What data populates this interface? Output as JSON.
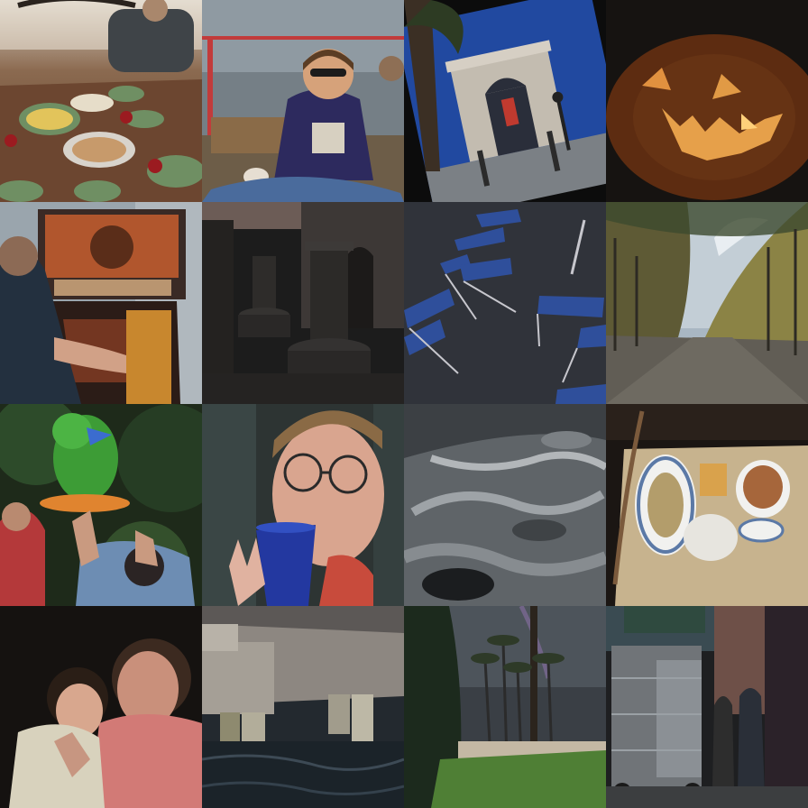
{
  "grid": {
    "rows": 4,
    "cols": 4,
    "tiles": [
      {
        "subject": "dinner-table",
        "palette": [
          "#6b4a32",
          "#d9b86a",
          "#6f8f63"
        ]
      },
      {
        "subject": "boat-deck-people",
        "palette": [
          "#6f7f88",
          "#2d2a5e",
          "#c98d5a"
        ]
      },
      {
        "subject": "arc-de-triomphe",
        "palette": [
          "#1f3f7e",
          "#b8b3aa",
          "#2d2a25"
        ]
      },
      {
        "subject": "jack-o-lantern",
        "palette": [
          "#1b1613",
          "#5a2a10",
          "#e39a42"
        ]
      },
      {
        "subject": "pinball-machine",
        "palette": [
          "#9aa6b0",
          "#2b1d18",
          "#c56f35"
        ]
      },
      {
        "subject": "stone-ruins",
        "palette": [
          "#1e1d1d",
          "#3b3a39",
          "#7a6253"
        ]
      },
      {
        "subject": "blue-folding-chairs",
        "palette": [
          "#2d3039",
          "#2f4f9b",
          "#c7c7cd"
        ]
      },
      {
        "subject": "tree-lined-park-path",
        "palette": [
          "#aab8c4",
          "#7b7b4d",
          "#565249"
        ]
      },
      {
        "subject": "green-parrot-pinata",
        "palette": [
          "#23311d",
          "#3ea039",
          "#b33a35"
        ]
      },
      {
        "subject": "man-with-blue-cup",
        "palette": [
          "#2c3434",
          "#e1aa93",
          "#233b9c"
        ]
      },
      {
        "subject": "tree-bark-texture",
        "palette": [
          "#1d1f21",
          "#6d7377",
          "#b9bcbf"
        ]
      },
      {
        "subject": "food-tray",
        "palette": [
          "#1c1713",
          "#c9b590",
          "#5b79a6"
        ]
      },
      {
        "subject": "woman-and-child",
        "palette": [
          "#1b1612",
          "#d07a74",
          "#d9d4c0"
        ]
      },
      {
        "subject": "bridge-pier-water",
        "palette": [
          "#5a5653",
          "#b6b0a6",
          "#1f2830"
        ]
      },
      {
        "subject": "palm-trees-rainbow",
        "palette": [
          "#2e3236",
          "#1c2b1e",
          "#5d8f3d"
        ]
      },
      {
        "subject": "street-food-cart",
        "palette": [
          "#1e1f21",
          "#6b7073",
          "#2c2d30"
        ]
      }
    ]
  }
}
